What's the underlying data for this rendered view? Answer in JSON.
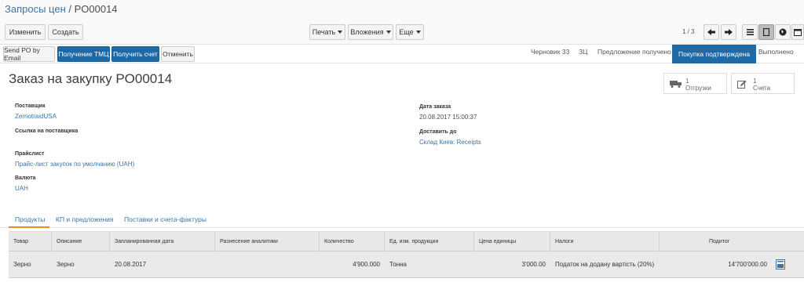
{
  "breadcrumb": {
    "parent": "Запросы цен",
    "separator": " / ",
    "current": "PO00014"
  },
  "toolbar": {
    "edit_label": "Изменить",
    "create_label": "Создать",
    "print_label": "Печать",
    "attachments_label": "Вложения",
    "more_label": "Еще",
    "pager": "1 / 3"
  },
  "actions": {
    "send_po": "Send PO by Email",
    "receive": "Получение ТМЦ",
    "get_invoice": "Получить счет",
    "cancel": "Отменить"
  },
  "stages": [
    "Черновик 33",
    "ЗЦ",
    "Предложение получено",
    "Покупка подтверждена",
    "Выполнено"
  ],
  "stage_current": "Покупка подтверждена",
  "record": {
    "title": "Заказ на закупку PO00014",
    "shipments_count": "1",
    "shipments_label": "Отгрузки",
    "invoices_count": "1",
    "invoices_label": "Счета",
    "supplier_label": "Поставщик",
    "supplier": "ZernotraidUSA",
    "supplier_ref_label": "Ссылка на поставщика",
    "pricelist_label": "Прайслист",
    "pricelist": "Прайс-лист закупок по умолчанию (UAH)",
    "currency_label": "Валюта",
    "currency": "UAH",
    "order_date_label": "Дата заказа",
    "order_date": "20.08.2017 15:00:37",
    "deliver_to_label": "Доставить до",
    "deliver_to": "Склад Киев: Receipts"
  },
  "tabs": [
    "Продукты",
    "КП и предложения",
    "Поставки и счета-фактуры"
  ],
  "table": {
    "columns": [
      "Товар",
      "Описание",
      "Запланированная дата",
      "Разнесение аналитики",
      "Количество",
      "Ед. изм. продукции",
      "Цена единицы",
      "Налоги",
      "Подитог"
    ],
    "rows": [
      [
        "Зерно",
        "Зерно",
        "20.08.2017",
        "",
        "4'900.000",
        "Тонна",
        "3'000.00",
        "Податок на додану вартість (20%)",
        "14'700'000.00"
      ]
    ]
  },
  "colors": {
    "accent": "#1f6aa5",
    "link": "#3a75a7",
    "tab_underline": "#f0882b"
  }
}
